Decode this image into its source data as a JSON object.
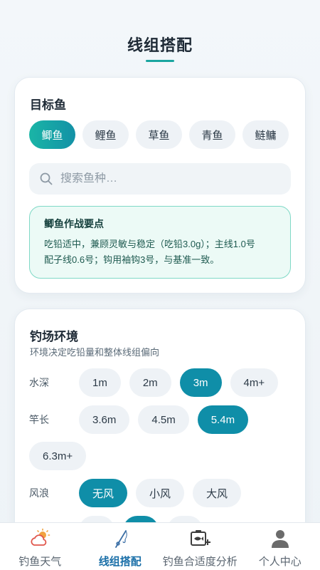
{
  "header": {
    "title": "线组搭配"
  },
  "target_fish": {
    "title": "目标鱼",
    "chips": [
      "鲫鱼",
      "鲤鱼",
      "草鱼",
      "青鱼",
      "鲢鳙"
    ],
    "selected": "鲫鱼",
    "search": {
      "placeholder": "搜索鱼种…",
      "value": ""
    },
    "tip": {
      "title": "鲫鱼作战要点",
      "line1": "吃铅适中，兼顾灵敏与稳定（吃铅3.0g）；主线1.0号",
      "line2": "配子线0.6号；钩用袖钩3号，与基准一致。"
    }
  },
  "environment": {
    "title": "钓场环境",
    "subtitle": "环境决定吃铅量和整体线组偏向",
    "depth": {
      "label": "水深",
      "options": [
        "1m",
        "2m",
        "3m",
        "4m+"
      ],
      "selected": "3m"
    },
    "rod": {
      "label": "竿长",
      "options": [
        "3.6m",
        "4.5m",
        "5.4m",
        "6.3m+"
      ],
      "selected": "5.4m"
    },
    "wind": {
      "label": "风浪",
      "options": [
        "无风",
        "小风",
        "大风"
      ],
      "selected": "无风"
    }
  },
  "colors": {
    "accent_teal": "#1aa5a0",
    "accent_blue": "#0f8ea8",
    "tab_active": "#1a6fa8"
  },
  "tabbar": {
    "items": [
      {
        "label": "钓鱼天气",
        "icon": "weather-icon"
      },
      {
        "label": "线组搭配",
        "icon": "fishing-rod-icon"
      },
      {
        "label": "钓鱼合适度分析",
        "icon": "fish-analysis-icon"
      },
      {
        "label": "个人中心",
        "icon": "person-icon"
      }
    ],
    "active": "线组搭配"
  }
}
